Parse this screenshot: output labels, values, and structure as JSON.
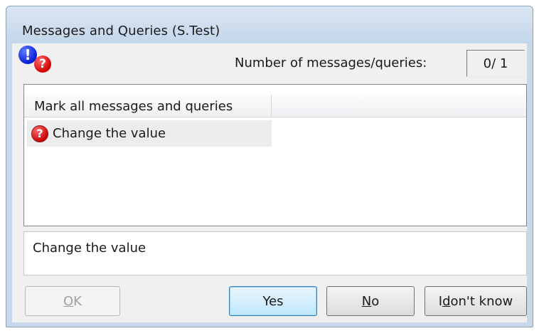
{
  "window": {
    "title": "Messages and Queries (S.Test)"
  },
  "header": {
    "counter_label": "Number of messages/queries:",
    "counter_value": "0/ 1"
  },
  "icons": {
    "message": "exclamation-icon",
    "query": "question-icon"
  },
  "list": {
    "column_header": "Mark all messages and queries",
    "items": [
      {
        "label": "Change the value",
        "icon": "question-icon"
      }
    ]
  },
  "detail": {
    "text": "Change the value"
  },
  "buttons": {
    "ok": {
      "pre": "",
      "key": "O",
      "post": "K"
    },
    "yes": {
      "label": "Yes"
    },
    "no": {
      "pre": "",
      "key": "N",
      "post": "o"
    },
    "idk": {
      "pre": "I ",
      "key": "d",
      "post": "on't know"
    }
  },
  "colors": {
    "title_bar": "#c4d6ea",
    "message_icon": "#0a1bd6",
    "query_icon": "#d00000",
    "default_button": "#bee6fd"
  }
}
